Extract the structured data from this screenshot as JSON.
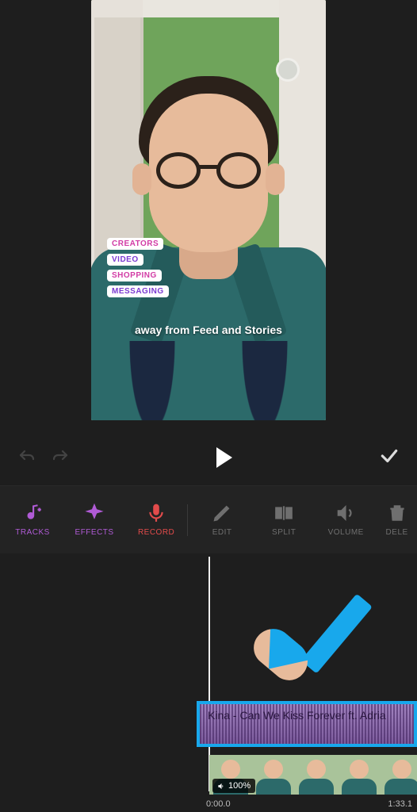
{
  "preview": {
    "tags": [
      "CREATORS",
      "VIDEO",
      "SHOPPING",
      "MESSAGING"
    ],
    "tag_colors": [
      "pink",
      "violet",
      "pink",
      "violet"
    ],
    "caption": "away from Feed and Stories"
  },
  "controls": {
    "undo_name": "undo-icon",
    "redo_name": "redo-icon",
    "play_name": "play-icon",
    "confirm_name": "check-icon"
  },
  "toolbar": {
    "items": [
      {
        "id": "tracks",
        "label": "TRACKS",
        "tone": "purple",
        "icon": "music-plus-icon",
        "interactable": true
      },
      {
        "id": "effects",
        "label": "EFFECTS",
        "tone": "purple",
        "icon": "sparkle-icon",
        "interactable": true
      },
      {
        "id": "record",
        "label": "RECORD",
        "tone": "red",
        "icon": "mic-icon",
        "interactable": true
      },
      {
        "id": "edit",
        "label": "EDIT",
        "tone": "grey",
        "icon": "pencil-icon",
        "interactable": false
      },
      {
        "id": "split",
        "label": "SPLIT",
        "tone": "grey",
        "icon": "split-icon",
        "interactable": false
      },
      {
        "id": "volume",
        "label": "VOLUME",
        "tone": "grey",
        "icon": "speaker-icon",
        "interactable": false
      },
      {
        "id": "delete",
        "label": "DELE",
        "tone": "grey",
        "icon": "trash-icon",
        "interactable": false
      }
    ]
  },
  "timeline": {
    "audio_clip_title": "Kina - Can We Kiss Forever ft. Adria",
    "volume_label": "100%",
    "time_start": "0:00.0",
    "time_end": "1:33.1",
    "annotation_arrow_color": "#18a8ec",
    "selection_border_color": "#18a8ec"
  }
}
